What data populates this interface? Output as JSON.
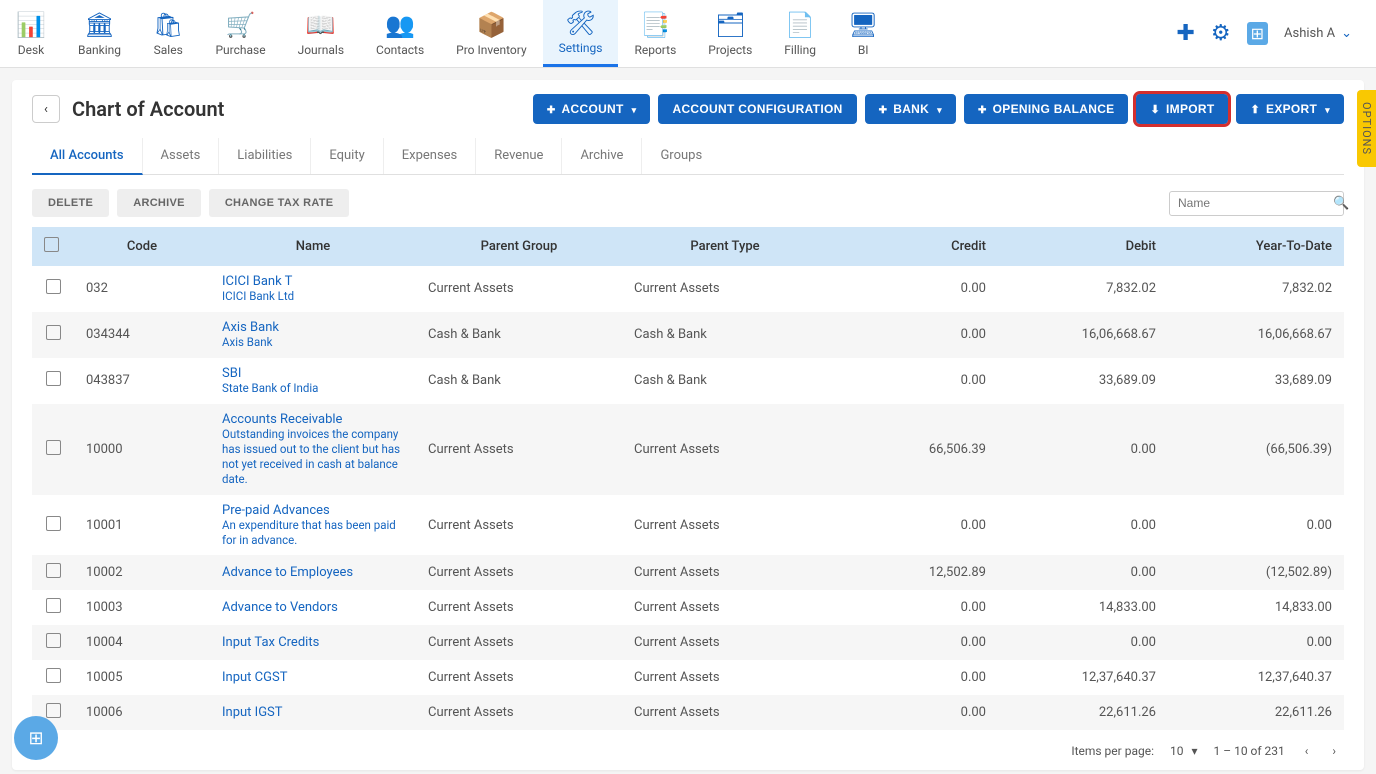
{
  "nav": {
    "items": [
      {
        "label": "Desk",
        "icon": "📊"
      },
      {
        "label": "Banking",
        "icon": "🏛"
      },
      {
        "label": "Sales",
        "icon": "🛍"
      },
      {
        "label": "Purchase",
        "icon": "🛒"
      },
      {
        "label": "Journals",
        "icon": "📖"
      },
      {
        "label": "Contacts",
        "icon": "👥"
      },
      {
        "label": "Pro Inventory",
        "icon": "📦"
      },
      {
        "label": "Settings",
        "icon": "🛠"
      },
      {
        "label": "Reports",
        "icon": "📑"
      },
      {
        "label": "Projects",
        "icon": "🗂"
      },
      {
        "label": "Filling",
        "icon": "📄"
      },
      {
        "label": "BI",
        "icon": "🖥"
      }
    ],
    "active_index": 7,
    "user": "Ashish A"
  },
  "page": {
    "title": "Chart of Account",
    "toolbar": {
      "account": "ACCOUNT",
      "config": "ACCOUNT CONFIGURATION",
      "bank": "BANK",
      "opening": "OPENING BALANCE",
      "import": "IMPORT",
      "export": "EXPORT"
    },
    "tabs": [
      "All Accounts",
      "Assets",
      "Liabilities",
      "Equity",
      "Expenses",
      "Revenue",
      "Archive",
      "Groups"
    ],
    "active_tab": 0,
    "sub_actions": {
      "delete": "DELETE",
      "archive": "ARCHIVE",
      "change_tax": "CHANGE TAX RATE",
      "search_placeholder": "Name"
    },
    "columns": [
      "Code",
      "Name",
      "Parent Group",
      "Parent Type",
      "Credit",
      "Debit",
      "Year-To-Date"
    ],
    "rows": [
      {
        "code": "032",
        "name": "ICICI Bank T",
        "sub": "ICICI Bank Ltd",
        "pg": "Current Assets",
        "pt": "Current Assets",
        "credit": "0.00",
        "debit": "7,832.02",
        "ytd": "7,832.02"
      },
      {
        "code": "034344",
        "name": "Axis Bank",
        "sub": "Axis Bank",
        "pg": "Cash & Bank",
        "pt": "Cash & Bank",
        "credit": "0.00",
        "debit": "16,06,668.67",
        "ytd": "16,06,668.67"
      },
      {
        "code": "043837",
        "name": "SBI",
        "sub": "State Bank of India",
        "pg": "Cash & Bank",
        "pt": "Cash & Bank",
        "credit": "0.00",
        "debit": "33,689.09",
        "ytd": "33,689.09"
      },
      {
        "code": "10000",
        "name": "Accounts Receivable",
        "sub": "Outstanding invoices the company has issued out to the client but has not yet received in cash at balance date.",
        "pg": "Current Assets",
        "pt": "Current Assets",
        "credit": "66,506.39",
        "debit": "0.00",
        "ytd": "(66,506.39)"
      },
      {
        "code": "10001",
        "name": "Pre-paid Advances",
        "sub": "An expenditure that has been paid for in advance.",
        "pg": "Current Assets",
        "pt": "Current Assets",
        "credit": "0.00",
        "debit": "0.00",
        "ytd": "0.00"
      },
      {
        "code": "10002",
        "name": "Advance to Employees",
        "sub": "",
        "pg": "Current Assets",
        "pt": "Current Assets",
        "credit": "12,502.89",
        "debit": "0.00",
        "ytd": "(12,502.89)"
      },
      {
        "code": "10003",
        "name": "Advance to Vendors",
        "sub": "",
        "pg": "Current Assets",
        "pt": "Current Assets",
        "credit": "0.00",
        "debit": "14,833.00",
        "ytd": "14,833.00"
      },
      {
        "code": "10004",
        "name": "Input Tax Credits",
        "sub": "",
        "pg": "Current Assets",
        "pt": "Current Assets",
        "credit": "0.00",
        "debit": "0.00",
        "ytd": "0.00"
      },
      {
        "code": "10005",
        "name": "Input CGST",
        "sub": "",
        "pg": "Current Assets",
        "pt": "Current Assets",
        "credit": "0.00",
        "debit": "12,37,640.37",
        "ytd": "12,37,640.37"
      },
      {
        "code": "10006",
        "name": "Input IGST",
        "sub": "",
        "pg": "Current Assets",
        "pt": "Current Assets",
        "credit": "0.00",
        "debit": "22,611.26",
        "ytd": "22,611.26"
      }
    ],
    "pagination": {
      "items_label": "Items per page:",
      "per_page": "10",
      "range": "1 – 10 of 231"
    },
    "options_tab": "OPTIONS"
  }
}
